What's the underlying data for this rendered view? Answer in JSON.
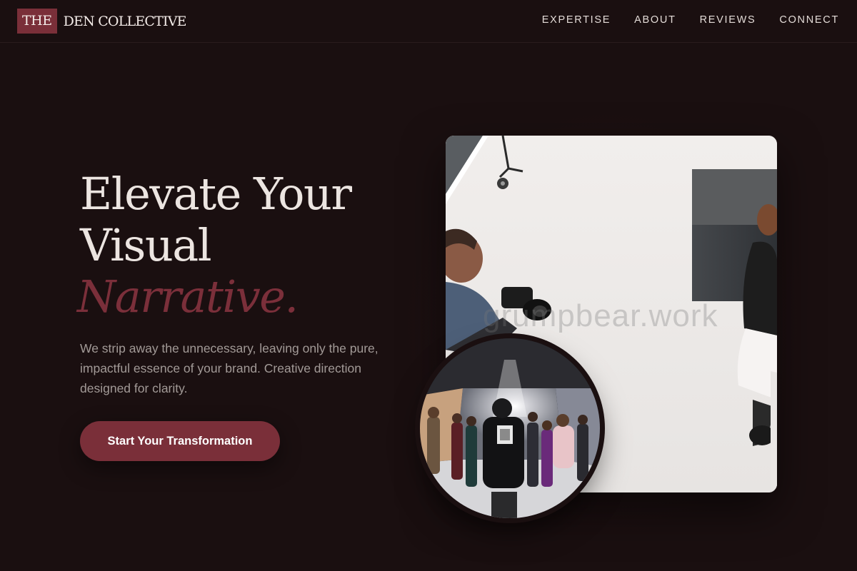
{
  "brand": {
    "mark": "THE",
    "name": "DEN COLLECTIVE",
    "accent_color": "#7a2f39",
    "background_color": "#1a0f10"
  },
  "nav": {
    "items": [
      {
        "label": "EXPERTISE"
      },
      {
        "label": "ABOUT"
      },
      {
        "label": "REVIEWS"
      },
      {
        "label": "CONNECT"
      }
    ]
  },
  "hero": {
    "title_line1": "Elevate Your",
    "title_line2": "Visual",
    "title_accent": "Narrative.",
    "description": "We strip away the unnecessary, leaving only the pure, impactful essence of your brand. Creative direction designed for clarity.",
    "cta_label": "Start Your Transformation"
  },
  "images": {
    "main_watermark": "grumpbear.work"
  }
}
